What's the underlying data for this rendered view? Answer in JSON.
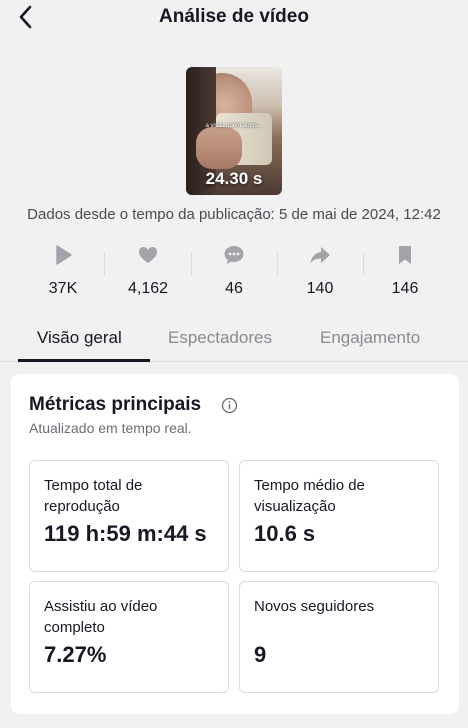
{
  "header": {
    "title": "Análise de vídeo",
    "back_icon": "chevron-left-icon"
  },
  "video": {
    "duration": "24.30 s",
    "caption": "a visão quem amos..."
  },
  "since_text": "Dados desde o tempo da publicação: 5 de mai de 2024, 12:42",
  "stats": [
    {
      "icon": "play-icon",
      "value": "37K"
    },
    {
      "icon": "heart-icon",
      "value": "4,162"
    },
    {
      "icon": "comment-icon",
      "value": "46"
    },
    {
      "icon": "share-icon",
      "value": "140"
    },
    {
      "icon": "bookmark-icon",
      "value": "146"
    }
  ],
  "tabs": [
    {
      "label": "Visão geral",
      "active": true
    },
    {
      "label": "Espectadores",
      "active": false
    },
    {
      "label": "Engajamento",
      "active": false
    }
  ],
  "key_metrics": {
    "title": "Métricas principais",
    "subtitle": "Atualizado em tempo real.",
    "items": [
      {
        "label": "Tempo total de reprodução",
        "value": "119 h:59 m:44 s"
      },
      {
        "label": "Tempo médio de visualização",
        "value": "10.6 s"
      },
      {
        "label": "Assistiu ao vídeo completo",
        "value": "7.27%"
      },
      {
        "label": "Novos seguidores",
        "value": "9"
      }
    ]
  },
  "colors": {
    "background": "#f1f1f2",
    "text": "#161823",
    "icon_gray": "#a3a4a9",
    "card": "#ffffff"
  }
}
